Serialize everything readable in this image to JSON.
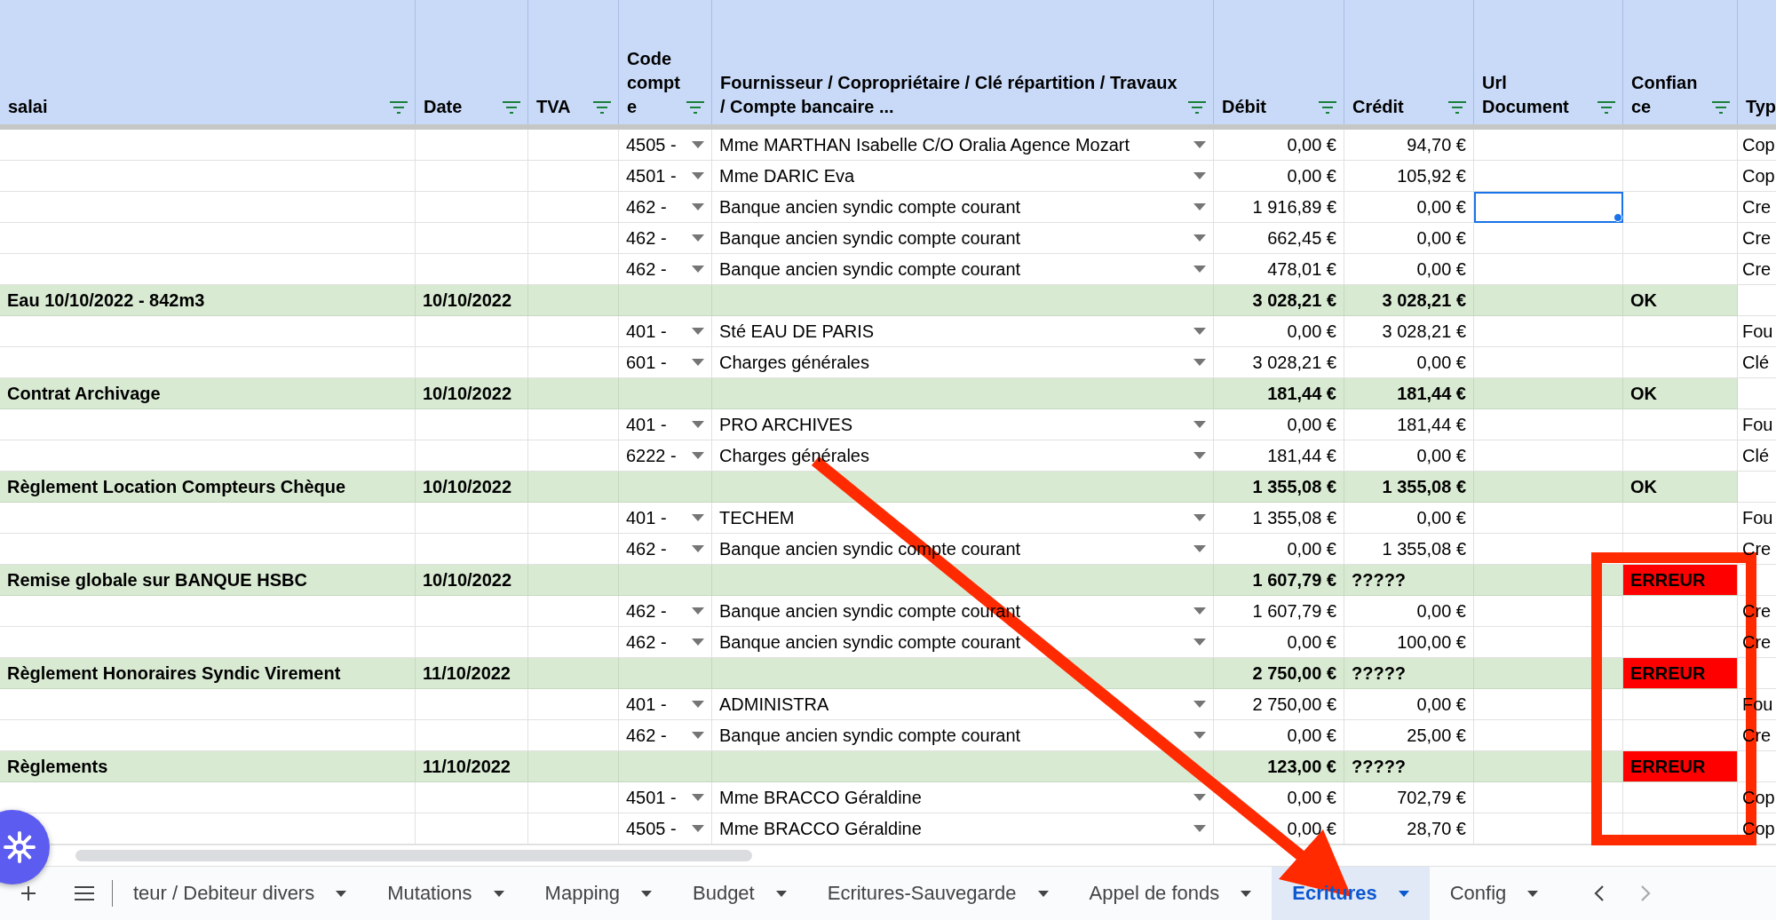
{
  "columns": [
    {
      "label": "salai",
      "filter": true
    },
    {
      "label": "Date",
      "filter": true
    },
    {
      "label": "TVA",
      "filter": true
    },
    {
      "label": "Code compte",
      "filter": true
    },
    {
      "label": "Fournisseur / Copropriétaire / Clé répartition / Travaux / Compte bancaire ...",
      "filter": true
    },
    {
      "label": "Débit",
      "filter": true
    },
    {
      "label": "Crédit",
      "filter": true
    },
    {
      "label": "Url Document",
      "filter": true
    },
    {
      "label": "Confiance",
      "filter": true
    },
    {
      "label": "Typ",
      "filter": false
    }
  ],
  "rows": [
    {
      "kind": "line",
      "code": "4505 -",
      "party": "Mme MARTHAN Isabelle C/O Oralia Agence Mozart",
      "debit": "0,00 €",
      "credit": "94,70 €",
      "type": "Cop",
      "selected": false
    },
    {
      "kind": "line",
      "code": "4501 -",
      "party": "Mme DARIC Eva",
      "debit": "0,00 €",
      "credit": "105,92 €",
      "type": "Cop",
      "selected": false
    },
    {
      "kind": "line",
      "code": "462 -",
      "party": "Banque ancien syndic compte courant",
      "debit": "1 916,89 €",
      "credit": "0,00 €",
      "type": "Cre",
      "selected": true
    },
    {
      "kind": "line",
      "code": "462 -",
      "party": "Banque ancien syndic compte courant",
      "debit": "662,45 €",
      "credit": "0,00 €",
      "type": "Cre",
      "selected": false
    },
    {
      "kind": "line",
      "code": "462 -",
      "party": "Banque ancien syndic compte courant",
      "debit": "478,01 €",
      "credit": "0,00 €",
      "type": "Cre",
      "selected": false
    },
    {
      "kind": "group",
      "label": "Eau 10/10/2022 - 842m3",
      "date": "10/10/2022",
      "debit": "3 028,21 €",
      "credit": "3 028,21 €",
      "status": "OK",
      "error": false
    },
    {
      "kind": "line",
      "code": "401 -",
      "party": "Sté EAU DE PARIS",
      "debit": "0,00 €",
      "credit": "3 028,21 €",
      "type": "Fou",
      "selected": false
    },
    {
      "kind": "line",
      "code": "601 -",
      "party": "Charges générales",
      "debit": "3 028,21 €",
      "credit": "0,00 €",
      "type": "Clé",
      "selected": false
    },
    {
      "kind": "group",
      "label": "Contrat Archivage",
      "date": "10/10/2022",
      "debit": "181,44 €",
      "credit": "181,44 €",
      "status": "OK",
      "error": false
    },
    {
      "kind": "line",
      "code": "401 -",
      "party": "PRO ARCHIVES",
      "debit": "0,00 €",
      "credit": "181,44 €",
      "type": "Fou",
      "selected": false
    },
    {
      "kind": "line",
      "code": "6222 -",
      "party": "Charges générales",
      "debit": "181,44 €",
      "credit": "0,00 €",
      "type": "Clé",
      "selected": false
    },
    {
      "kind": "group",
      "label": "Règlement Location Compteurs Chèque",
      "date": "10/10/2022",
      "debit": "1 355,08 €",
      "credit": "1 355,08 €",
      "status": "OK",
      "error": false
    },
    {
      "kind": "line",
      "code": "401 -",
      "party": "TECHEM",
      "debit": "1 355,08 €",
      "credit": "0,00 €",
      "type": "Fou",
      "selected": false
    },
    {
      "kind": "line",
      "code": "462 -",
      "party": "Banque ancien syndic compte courant",
      "debit": "0,00 €",
      "credit": "1 355,08 €",
      "type": "Cre",
      "selected": false
    },
    {
      "kind": "group",
      "label": "Remise globale sur BANQUE HSBC",
      "date": "10/10/2022",
      "debit": "1 607,79 €",
      "credit": "?????",
      "status": "ERREUR",
      "error": true
    },
    {
      "kind": "line",
      "code": "462 -",
      "party": "Banque ancien syndic compte courant",
      "debit": "1 607,79 €",
      "credit": "0,00 €",
      "type": "Cre",
      "selected": false
    },
    {
      "kind": "line",
      "code": "462 -",
      "party": "Banque ancien syndic compte courant",
      "debit": "0,00 €",
      "credit": "100,00 €",
      "type": "Cre",
      "selected": false
    },
    {
      "kind": "group",
      "label": "Règlement Honoraires Syndic Virement",
      "date": "11/10/2022",
      "debit": "2 750,00 €",
      "credit": "?????",
      "status": "ERREUR",
      "error": true
    },
    {
      "kind": "line",
      "code": "401 -",
      "party": "ADMINISTRA",
      "debit": "2 750,00 €",
      "credit": "0,00 €",
      "type": "Fou",
      "selected": false
    },
    {
      "kind": "line",
      "code": "462 -",
      "party": "Banque ancien syndic compte courant",
      "debit": "0,00 €",
      "credit": "25,00 €",
      "type": "Cre",
      "selected": false
    },
    {
      "kind": "group",
      "label": "Règlements",
      "date": "11/10/2022",
      "debit": "123,00 €",
      "credit": "?????",
      "status": "ERREUR",
      "error": true
    },
    {
      "kind": "line",
      "code": "4501 -",
      "party": "Mme BRACCO Géraldine",
      "debit": "0,00 €",
      "credit": "702,79 €",
      "type": "Cop",
      "selected": false
    },
    {
      "kind": "line",
      "code": "4505 -",
      "party": "Mme BRACCO Géraldine",
      "debit": "0,00 €",
      "credit": "28,70 €",
      "type": "Cop",
      "selected": false
    }
  ],
  "sheet_tabs": [
    {
      "label": "teur / Debiteur divers",
      "selected": false
    },
    {
      "label": "Mutations",
      "selected": false
    },
    {
      "label": "Mapping",
      "selected": false
    },
    {
      "label": "Budget",
      "selected": false
    },
    {
      "label": "Ecritures-Sauvegarde",
      "selected": false
    },
    {
      "label": "Appel de fonds",
      "selected": false
    },
    {
      "label": "Ecritures",
      "selected": true
    },
    {
      "label": "Config",
      "selected": false
    }
  ]
}
